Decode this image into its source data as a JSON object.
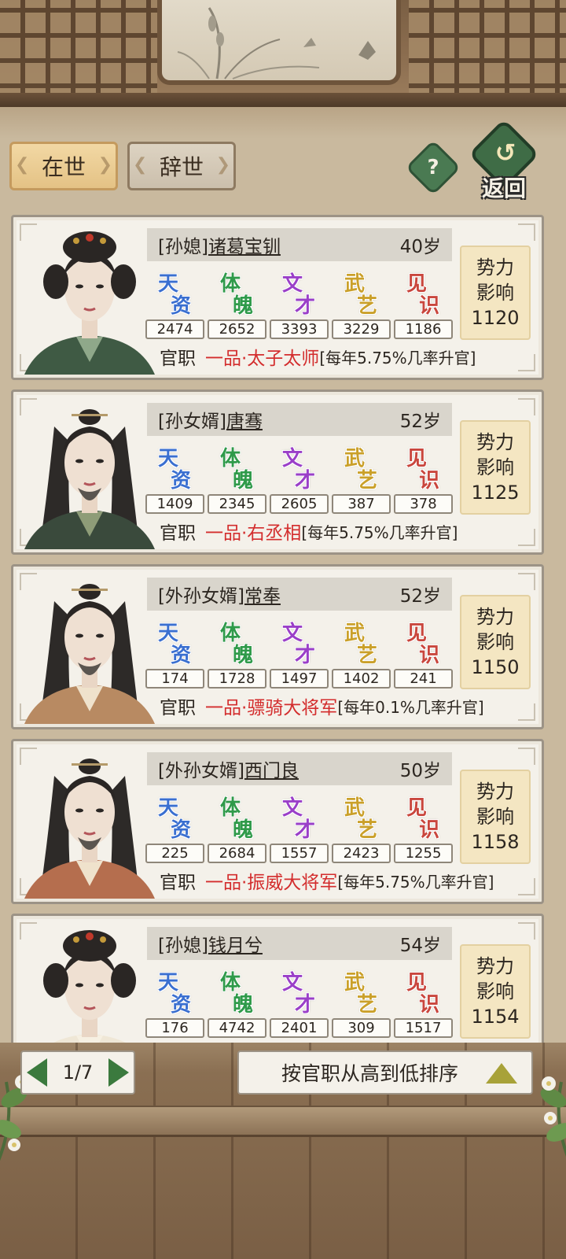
{
  "tabs": {
    "alive": "在世",
    "deceased": "辞世"
  },
  "buttons": {
    "help": "?",
    "back": "返回"
  },
  "attribute_labels": [
    {
      "c1": "天",
      "c2": "资",
      "color": "#3a6fd0"
    },
    {
      "c1": "体",
      "c2": "魄",
      "color": "#2f9a4a"
    },
    {
      "c1": "文",
      "c2": "才",
      "color": "#9a3fc8"
    },
    {
      "c1": "武",
      "c2": "艺",
      "color": "#caa02a"
    },
    {
      "c1": "见",
      "c2": "识",
      "color": "#c9463d"
    }
  ],
  "office_label": "官职",
  "influence_label_1": "势力",
  "influence_label_2": "影响",
  "members": [
    {
      "relation": "[孙媳]",
      "name": "诸葛宝钏",
      "age": "40岁",
      "attrs": [
        "2474",
        "2652",
        "3393",
        "3229",
        "1186"
      ],
      "office": "一品·太子太师",
      "note": "[每年5.75%几率升官]",
      "influence": "1120",
      "gender": "female",
      "robe": "#3f5a44",
      "inner": "#8fa88a"
    },
    {
      "relation": "[孙女婿]",
      "name": "唐骞",
      "age": "52岁",
      "attrs": [
        "1409",
        "2345",
        "2605",
        "387",
        "378"
      ],
      "office": "一品·右丞相",
      "note": "[每年5.75%几率升官]",
      "influence": "1125",
      "gender": "male",
      "robe": "#3a4a3c",
      "inner": "#8e9c78"
    },
    {
      "relation": "[外孙女婿]",
      "name": "常奉",
      "age": "52岁",
      "attrs": [
        "174",
        "1728",
        "1497",
        "1402",
        "241"
      ],
      "office": "一品·骠骑大将军",
      "note": "[每年0.1%几率升官]",
      "influence": "1150",
      "gender": "male",
      "robe": "#b88a62",
      "inner": "#efe2cc"
    },
    {
      "relation": "[外孙女婿]",
      "name": "西门良",
      "age": "50岁",
      "attrs": [
        "225",
        "2684",
        "1557",
        "2423",
        "1255"
      ],
      "office": "一品·振威大将军",
      "note": "[每年5.75%几率升官]",
      "influence": "1158",
      "gender": "male",
      "robe": "#b56e4e",
      "inner": "#efe2cc"
    },
    {
      "relation": "[孙媳]",
      "name": "钱月兮",
      "age": "54岁",
      "attrs": [
        "176",
        "4742",
        "2401",
        "309",
        "1517"
      ],
      "office": "",
      "note": "",
      "influence": "1154",
      "gender": "female",
      "robe": "#efe7d6",
      "inner": "#f6f0e2"
    }
  ],
  "pagination": {
    "page": "1/7"
  },
  "sort": {
    "label": "按官职从高到低排序"
  },
  "icons": [
    "help-icon",
    "back-arrow-icon",
    "prev-page-icon",
    "next-page-icon",
    "sort-ascending-icon"
  ]
}
